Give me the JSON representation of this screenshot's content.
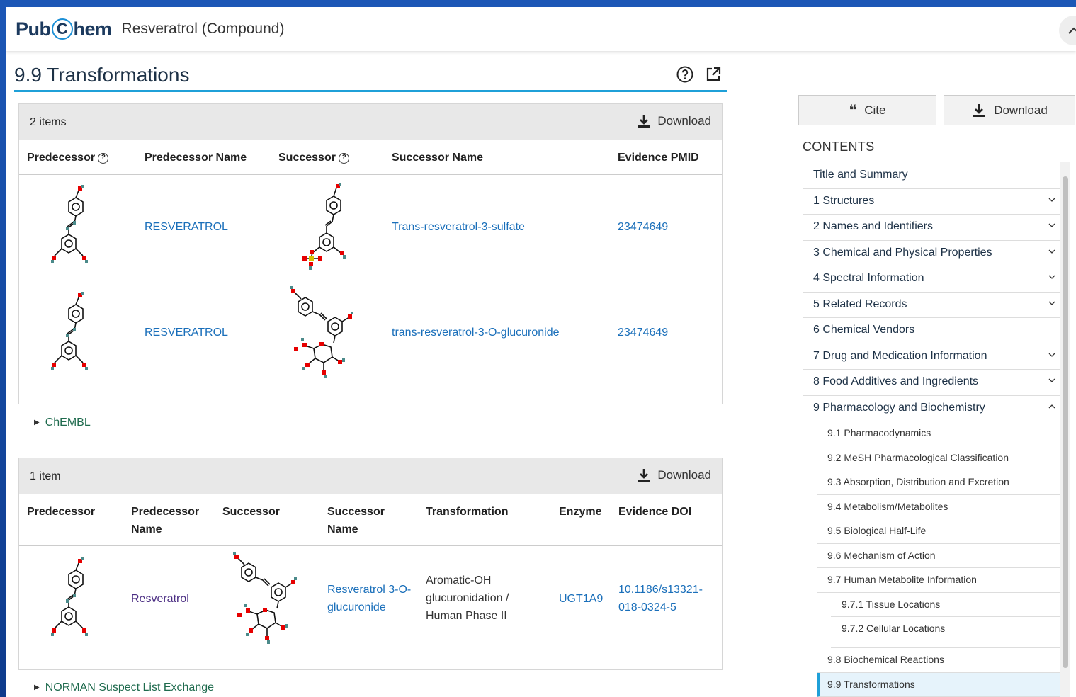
{
  "app": {
    "logo_left": "Pub",
    "logo_c": "C",
    "logo_right": "hem",
    "title": "Resveratrol (Compound)"
  },
  "section": {
    "title": "9.9 Transformations"
  },
  "table1": {
    "count": "2 items",
    "download": "Download",
    "headers": [
      "Predecessor",
      "Predecessor Name",
      "Successor",
      "Successor Name",
      "Evidence PMID"
    ],
    "rows": [
      {
        "predecessor_name": "RESVERATROL",
        "successor_name": "Trans-resveratrol-3-sulfate",
        "pmid": "23474649"
      },
      {
        "predecessor_name": "RESVERATROL",
        "successor_name": "trans-resveratrol-3-O-glucuronide",
        "pmid": "23474649"
      }
    ],
    "source": "ChEMBL"
  },
  "table2": {
    "count": "1 item",
    "download": "Download",
    "headers": [
      "Predecessor",
      "Predecessor Name",
      "Successor",
      "Successor Name",
      "Transformation",
      "Enzyme",
      "Evidence DOI"
    ],
    "rows": [
      {
        "predecessor_name": "Resveratrol",
        "successor_name": "Resveratrol 3-O-glucuronide",
        "transformation": "Aromatic-OH glucuronidation / Human Phase II",
        "enzyme": "UGT1A9",
        "doi": "10.1186/s13321-018-0324-5"
      }
    ],
    "source": "NORMAN Suspect List Exchange"
  },
  "sidebar": {
    "cite": "Cite",
    "download": "Download",
    "contents_label": "CONTENTS",
    "toc": [
      {
        "label": "Title and Summary",
        "chevron": ""
      },
      {
        "label": "1 Structures",
        "chevron": "down"
      },
      {
        "label": "2 Names and Identifiers",
        "chevron": "down"
      },
      {
        "label": "3 Chemical and Physical Properties",
        "chevron": "down"
      },
      {
        "label": "4 Spectral Information",
        "chevron": "down"
      },
      {
        "label": "5 Related Records",
        "chevron": "down"
      },
      {
        "label": "6 Chemical Vendors",
        "chevron": ""
      },
      {
        "label": "7 Drug and Medication Information",
        "chevron": "down"
      },
      {
        "label": "8 Food Additives and Ingredients",
        "chevron": "down"
      },
      {
        "label": "9 Pharmacology and Biochemistry",
        "chevron": "up"
      }
    ],
    "subtoc": [
      {
        "label": "9.1 Pharmacodynamics",
        "level": 2
      },
      {
        "label": "9.2 MeSH Pharmacological Classification",
        "level": 2
      },
      {
        "label": "9.3 Absorption, Distribution and Excretion",
        "level": 2
      },
      {
        "label": "9.4 Metabolism/Metabolites",
        "level": 2
      },
      {
        "label": "9.5 Biological Half-Life",
        "level": 2
      },
      {
        "label": "9.6 Mechanism of Action",
        "level": 2
      },
      {
        "label": "9.7 Human Metabolite Information",
        "level": 2
      },
      {
        "label": "9.7.1 Tissue Locations",
        "level": 3
      },
      {
        "label": "9.7.2 Cellular Locations",
        "level": 3
      },
      {
        "label": "9.8 Biochemical Reactions",
        "level": 2
      },
      {
        "label": "9.9 Transformations",
        "level": 2,
        "active": true
      }
    ]
  },
  "colors": {
    "accent": "#1fa0d8",
    "link": "#1a6fba",
    "source_link": "#1f6b4e"
  }
}
